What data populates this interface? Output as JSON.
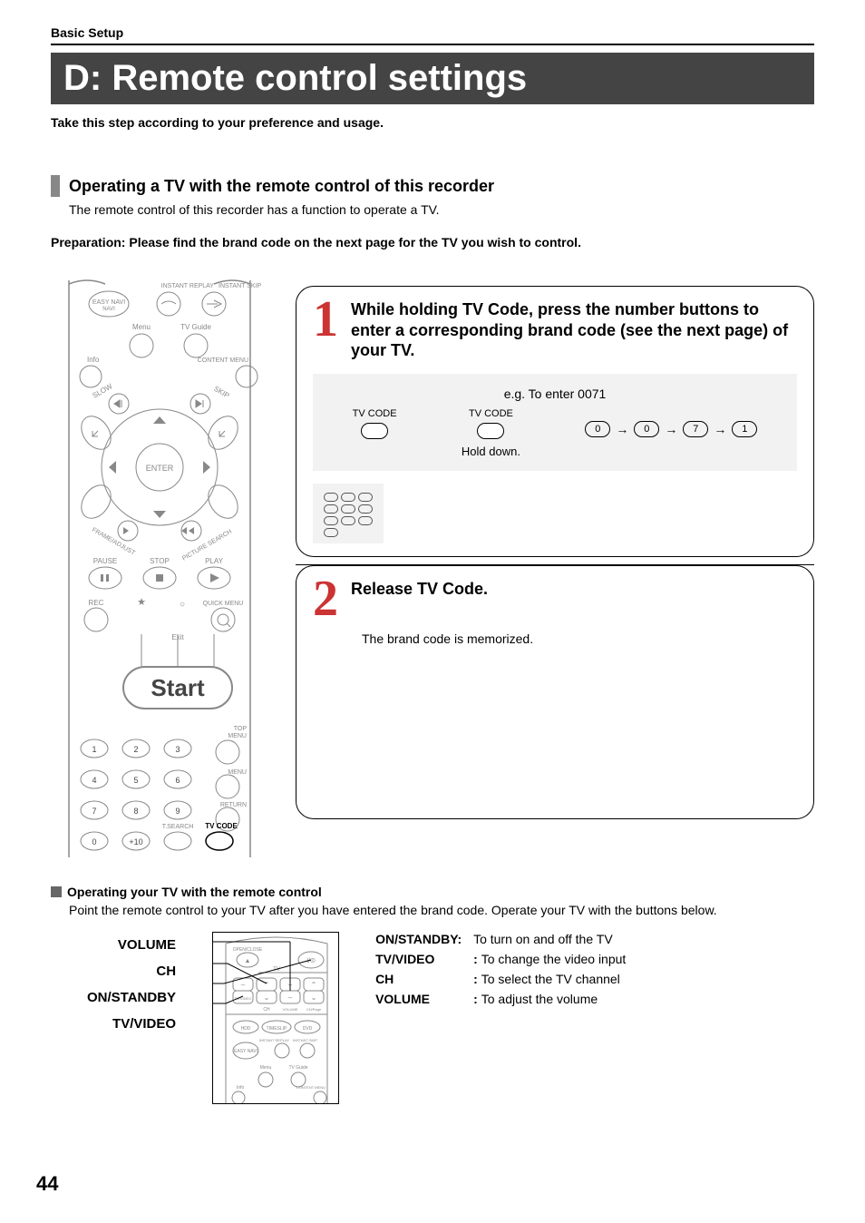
{
  "header": {
    "section": "Basic Setup"
  },
  "title": "D: Remote control settings",
  "intro": "Take this step according to your preference and usage.",
  "operating_tv": {
    "heading": "Operating a TV with the remote control of this recorder",
    "sub": "The remote control of this recorder has a function to operate a TV.",
    "preparation": "Preparation: Please find the brand code on the next page for the TV you wish to control."
  },
  "remote_labels": {
    "instant_replay": "INSTANT REPLAY",
    "instant_skip": "INSTANT SKIP",
    "easy_navi": "EASY NAVI",
    "menu": "Menu",
    "tv_guide": "TV Guide",
    "info": "Info",
    "content_menu": "CONTENT MENU",
    "slow": "SLOW",
    "skip": "SKIP",
    "enter": "ENTER",
    "frame_adjust": "FRAME/ADJUST",
    "picture_search": "PICTURE SEARCH",
    "pause": "PAUSE",
    "stop": "STOP",
    "play": "PLAY",
    "rec": "REC",
    "quick_menu": "QUICK MENU",
    "exit": "Exit",
    "start": "Start",
    "top_menu": "TOP MENU",
    "menu2": "MENU",
    "return": "RETURN",
    "t_search": "T.SEARCH",
    "tv_code": "TV CODE",
    "plus10": "+10",
    "d1": "1",
    "d2": "2",
    "d3": "3",
    "d4": "4",
    "d5": "5",
    "d6": "6",
    "d7": "7",
    "d8": "8",
    "d9": "9",
    "d0": "0"
  },
  "steps": {
    "s1": {
      "num": "1",
      "title": "While holding TV Code, press the number buttons to enter a corresponding brand code (see the next page) of your TV.",
      "example_prefix": "e.g. To enter 0071",
      "tvcode_label": "TV CODE",
      "hold": "Hold down.",
      "seq": [
        "0",
        "0",
        "7",
        "1"
      ]
    },
    "s2": {
      "num": "2",
      "title": "Release TV Code.",
      "body": "The brand code is memorized."
    }
  },
  "op_tv": {
    "heading": "Operating your TV with the remote control",
    "sub": "Point the remote control to your TV after you have entered the brand code. Operate your TV with the buttons below.",
    "callouts": {
      "volume": "VOLUME",
      "ch": "CH",
      "on_standby": "ON/STANDBY",
      "tv_video": "TV/VIDEO"
    },
    "mini_remote": {
      "open_close": "OPEN/CLOSE",
      "tv": "TV",
      "power": "I/⏼",
      "tv_video": "TV/VIDEO",
      "ch": "CH",
      "volume": "VOLUME",
      "ch_page": "CH/Page",
      "hdd": "HDD",
      "timeslip": "TIMESLIP",
      "dvd": "DVD",
      "instant_replay": "INSTANT REPLAY",
      "instant_skip": "INSTANT SKIP",
      "easy_navi": "EASY NAVI",
      "menu": "Menu",
      "tv_guide": "TV Guide",
      "info": "Info",
      "content_menu": "CONTENT MENU"
    },
    "defs": [
      {
        "label": "ON/STANDBY",
        "text": "To turn on and off the TV"
      },
      {
        "label": "TV/VIDEO",
        "text": "To change the video input"
      },
      {
        "label": "CH",
        "text": "To select the TV channel"
      },
      {
        "label": "VOLUME",
        "text": "To adjust the volume"
      }
    ]
  },
  "page_number": "44"
}
